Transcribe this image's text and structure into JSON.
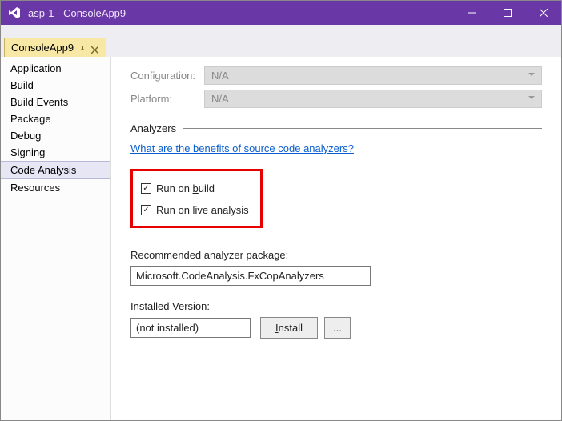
{
  "window": {
    "title": "asp-1 - ConsoleApp9"
  },
  "tab": {
    "label": "ConsoleApp9"
  },
  "sidebar": {
    "items": [
      {
        "label": "Application"
      },
      {
        "label": "Build"
      },
      {
        "label": "Build Events"
      },
      {
        "label": "Package"
      },
      {
        "label": "Debug"
      },
      {
        "label": "Signing"
      },
      {
        "label": "Code Analysis"
      },
      {
        "label": "Resources"
      }
    ],
    "selected": 6
  },
  "config": {
    "config_label": "Configuration:",
    "config_value": "N/A",
    "platform_label": "Platform:",
    "platform_value": "N/A"
  },
  "section": {
    "analyzers": "Analyzers"
  },
  "link": {
    "benefits": "What are the benefits of source code analyzers?"
  },
  "checkboxes": {
    "run_build_pre": "Run on ",
    "run_build_m": "b",
    "run_build_post": "uild",
    "run_live_pre": "Run on ",
    "run_live_m": "l",
    "run_live_post": "ive analysis",
    "run_build_checked": true,
    "run_live_checked": true
  },
  "recommended": {
    "label": "Recommended analyzer package:",
    "value": "Microsoft.CodeAnalysis.FxCopAnalyzers"
  },
  "installed": {
    "label": "Installed Version:",
    "value": "(not installed)",
    "install_btn_pre": "",
    "install_btn_m": "I",
    "install_btn_post": "nstall",
    "browse_btn": "..."
  }
}
